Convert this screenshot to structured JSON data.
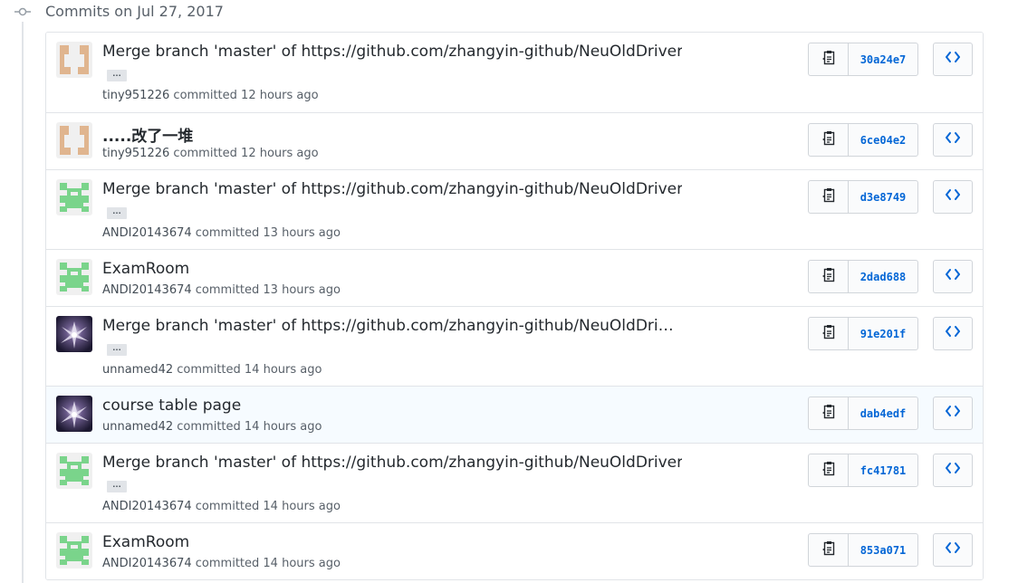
{
  "group": {
    "title": "Commits on Jul 27, 2017",
    "icon": "git-commit-icon"
  },
  "colors": {
    "link": "#0366d6",
    "text": "#24292e",
    "muted": "#586069",
    "border": "#e1e4e8",
    "highlight_row": "#f6fbff"
  },
  "icons": {
    "copy": "clipboard-icon",
    "browse": "code-icon"
  },
  "commits": [
    {
      "title": "Merge branch 'master' of https://github.com/zhangyin-github/NeuOldDriver",
      "has_ellipsis": true,
      "ellipsis": "…",
      "author": "tiny951226",
      "action": "committed",
      "time": "12 hours ago",
      "sha": "30a24e7",
      "avatar": "tiny951226"
    },
    {
      "title": ".....改了一堆",
      "has_ellipsis": false,
      "author": "tiny951226",
      "action": "committed",
      "time": "12 hours ago",
      "sha": "6ce04e2",
      "avatar": "tiny951226"
    },
    {
      "title": "Merge branch 'master' of https://github.com/zhangyin-github/NeuOldDriver",
      "has_ellipsis": true,
      "ellipsis": "…",
      "author": "ANDI20143674",
      "action": "committed",
      "time": "13 hours ago",
      "sha": "d3e8749",
      "avatar": "ANDI20143674"
    },
    {
      "title": "ExamRoom",
      "has_ellipsis": false,
      "author": "ANDI20143674",
      "action": "committed",
      "time": "13 hours ago",
      "sha": "2dad688",
      "avatar": "ANDI20143674"
    },
    {
      "title": "Merge branch 'master' of https://github.com/zhangyin-github/NeuOldDri…",
      "has_ellipsis": true,
      "ellipsis": "…",
      "author": "unnamed42",
      "action": "committed",
      "time": "14 hours ago",
      "sha": "91e201f",
      "avatar": "unnamed42"
    },
    {
      "title": "course table page",
      "has_ellipsis": false,
      "author": "unnamed42",
      "action": "committed",
      "time": "14 hours ago",
      "sha": "dab4edf",
      "avatar": "unnamed42"
    },
    {
      "title": "Merge branch 'master' of https://github.com/zhangyin-github/NeuOldDriver",
      "has_ellipsis": true,
      "ellipsis": "…",
      "author": "ANDI20143674",
      "action": "committed",
      "time": "14 hours ago",
      "sha": "fc41781",
      "avatar": "ANDI20143674"
    },
    {
      "title": "ExamRoom",
      "has_ellipsis": false,
      "author": "ANDI20143674",
      "action": "committed",
      "time": "14 hours ago",
      "sha": "853a071",
      "avatar": "ANDI20143674"
    }
  ]
}
